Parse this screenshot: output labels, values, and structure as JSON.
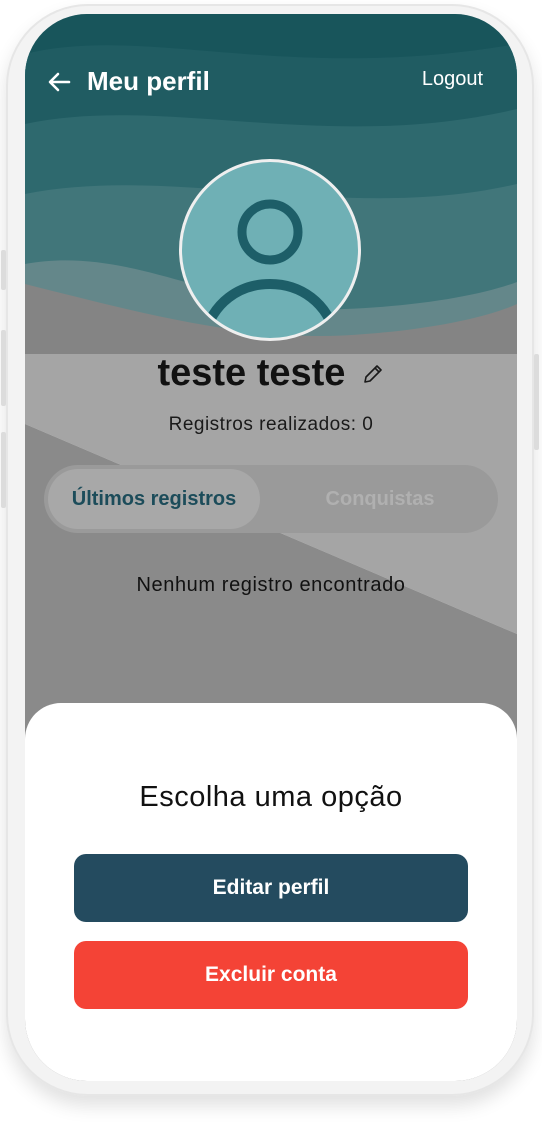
{
  "topbar": {
    "back_icon": "arrow-left-icon",
    "title": "Meu perfil",
    "logout_label": "Logout"
  },
  "profile": {
    "avatar_icon": "user-icon",
    "name": "teste teste",
    "edit_icon": "pencil-icon",
    "records_text": "Registros realizados: 0"
  },
  "tabs": [
    {
      "label": "Últimos registros",
      "active": true
    },
    {
      "label": "Conquistas",
      "active": false
    }
  ],
  "empty_message": "Nenhum registro encontrado",
  "sheet": {
    "title": "Escolha uma opção",
    "edit_label": "Editar perfil",
    "delete_label": "Excluir conta"
  },
  "colors": {
    "header_teal": "#1e6b73",
    "primary_button": "#244b5f",
    "danger_button": "#f44336",
    "active_tab_text": "#1c4c5a"
  }
}
